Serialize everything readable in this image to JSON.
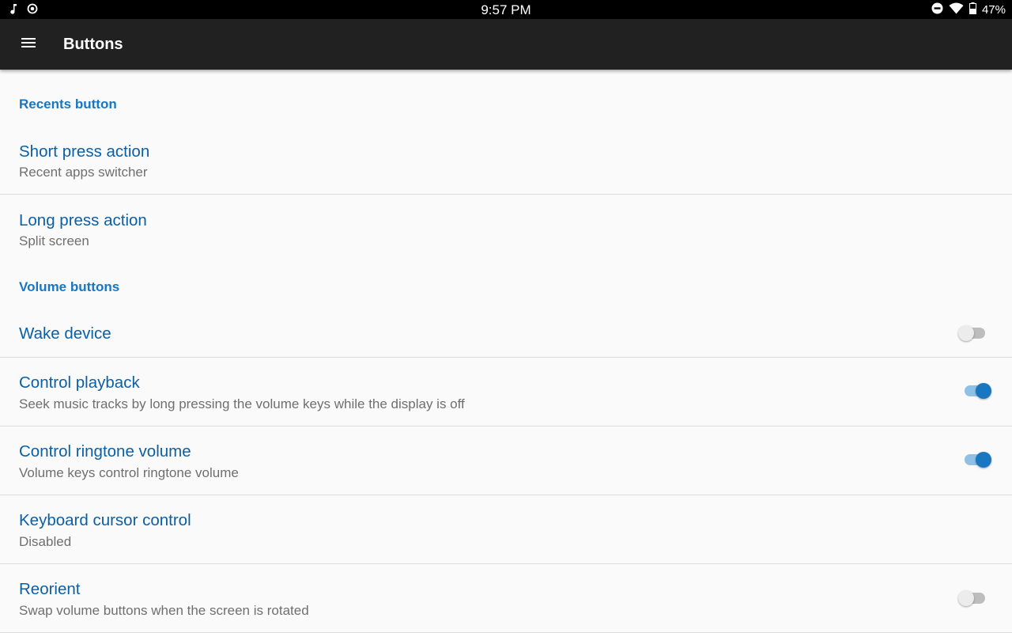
{
  "status_bar": {
    "time": "9:57 PM",
    "battery": "47%",
    "icons_left": [
      "music-note-icon",
      "sync-circle-icon"
    ],
    "icons_right": [
      "do-not-disturb-icon",
      "wifi-icon",
      "battery-icon"
    ]
  },
  "app_bar": {
    "title": "Buttons",
    "menu_icon": "hamburger-menu-icon"
  },
  "colors": {
    "accent": "#1976c0",
    "title_text": "#0b5fa5",
    "app_bar": "#212121"
  },
  "sections": [
    {
      "header": "Recents button",
      "items": [
        {
          "title": "Short press action",
          "summary": "Recent apps switcher"
        },
        {
          "title": "Long press action",
          "summary": "Split screen"
        }
      ]
    },
    {
      "header": "Volume buttons",
      "items": [
        {
          "title": "Wake device",
          "switch": false
        },
        {
          "title": "Control playback",
          "summary": "Seek music tracks by long pressing the volume keys while the display is off",
          "switch": true
        },
        {
          "title": "Control ringtone volume",
          "summary": "Volume keys control ringtone volume",
          "switch": true
        },
        {
          "title": "Keyboard cursor control",
          "summary": "Disabled"
        },
        {
          "title": "Reorient",
          "summary": "Swap volume buttons when the screen is rotated",
          "switch": false
        }
      ]
    }
  ]
}
